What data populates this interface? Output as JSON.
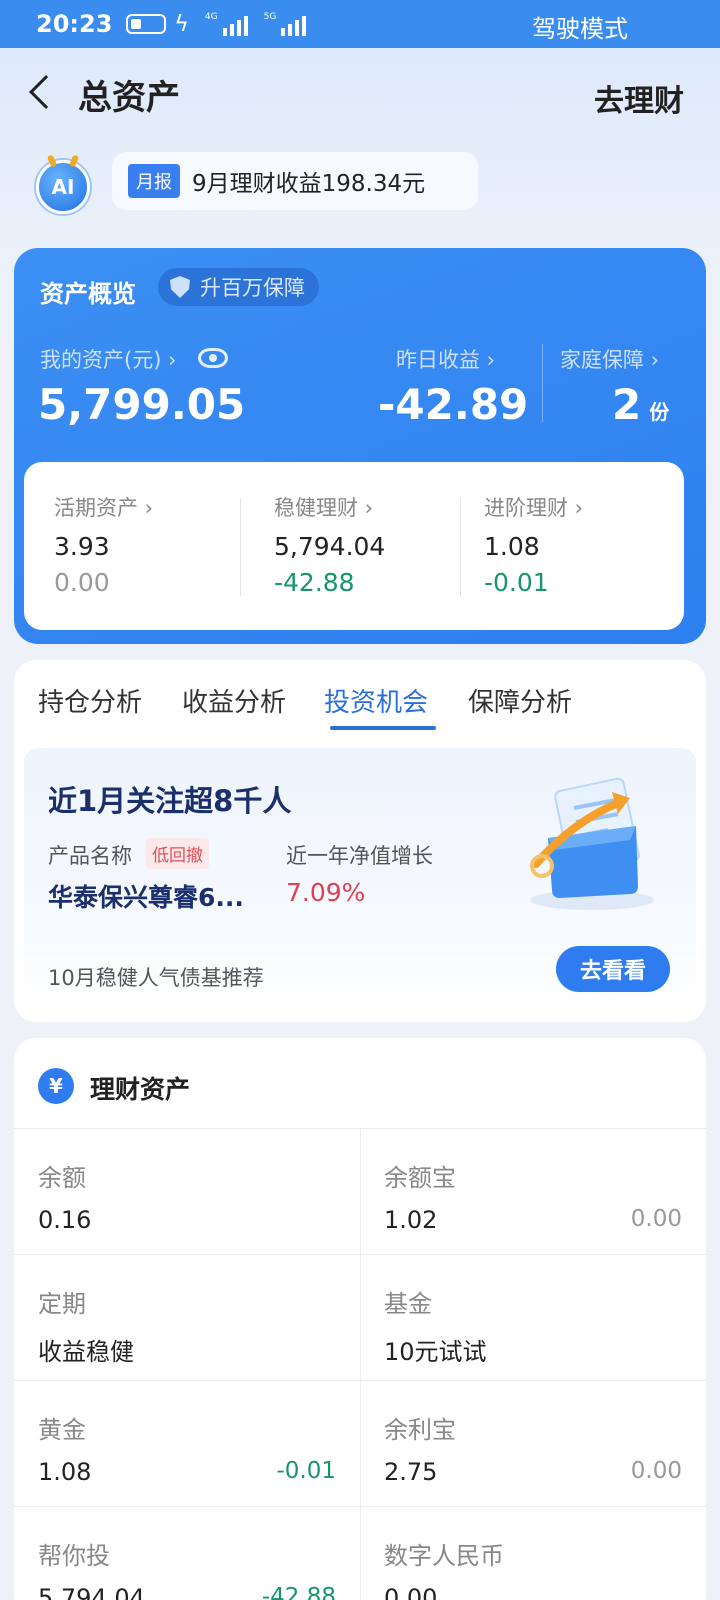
{
  "status_bar": {
    "time": "20:23",
    "net1": "4G",
    "net2": "5G",
    "driving_mode": "驾驶模式"
  },
  "nav": {
    "title": "总资产",
    "action": "去理财"
  },
  "report": {
    "logo": "AI",
    "tag": "月报",
    "text": "9月理财收益198.34元"
  },
  "overview": {
    "title": "资产概览",
    "badge": "升百万保障",
    "my_assets_label": "我的资产(元) ›",
    "my_assets_value": "5,799.05",
    "yesterday_label": "昨日收益 ›",
    "yesterday_value": "-42.89",
    "family_label": "家庭保障 ›",
    "family_value": "2",
    "family_unit": "份",
    "sub": [
      {
        "label": "活期资产 ›",
        "value": "3.93",
        "change": "0.00"
      },
      {
        "label": "稳健理财 ›",
        "value": "5,794.04",
        "change": "-42.88"
      },
      {
        "label": "进阶理财 ›",
        "value": "1.08",
        "change": "-0.01"
      }
    ]
  },
  "tabs": [
    {
      "label": "持仓分析"
    },
    {
      "label": "收益分析"
    },
    {
      "label": "投资机会"
    },
    {
      "label": "保障分析"
    }
  ],
  "opportunity": {
    "headline": "近1月关注超8千人",
    "product_label": "产品名称",
    "product_tag": "低回撤",
    "growth_label": "近一年净值增长",
    "product_name": "华泰保兴尊睿6...",
    "growth_value": "7.09%",
    "recommend": "10月稳健人气债基推荐",
    "button": "去看看"
  },
  "finance": {
    "icon": "¥",
    "title": "理财资产",
    "cells": [
      {
        "label": "余额",
        "value": "0.16",
        "change": ""
      },
      {
        "label": "余额宝",
        "value": "1.02",
        "change": "0.00"
      },
      {
        "label": "定期",
        "value": "收益稳健",
        "change": ""
      },
      {
        "label": "基金",
        "value": "10元试试",
        "change": ""
      },
      {
        "label": "黄金",
        "value": "1.08",
        "change": "-0.01"
      },
      {
        "label": "余利宝",
        "value": "2.75",
        "change": "0.00"
      },
      {
        "label": "帮你投",
        "value": "5,794.04",
        "change": "-42.88"
      },
      {
        "label": "数字人民币",
        "value": "0.00",
        "change": ""
      }
    ]
  },
  "colors": {
    "primary": "#2f7bf0",
    "positive_green": "#17966b",
    "negative_red": "#e04050"
  }
}
